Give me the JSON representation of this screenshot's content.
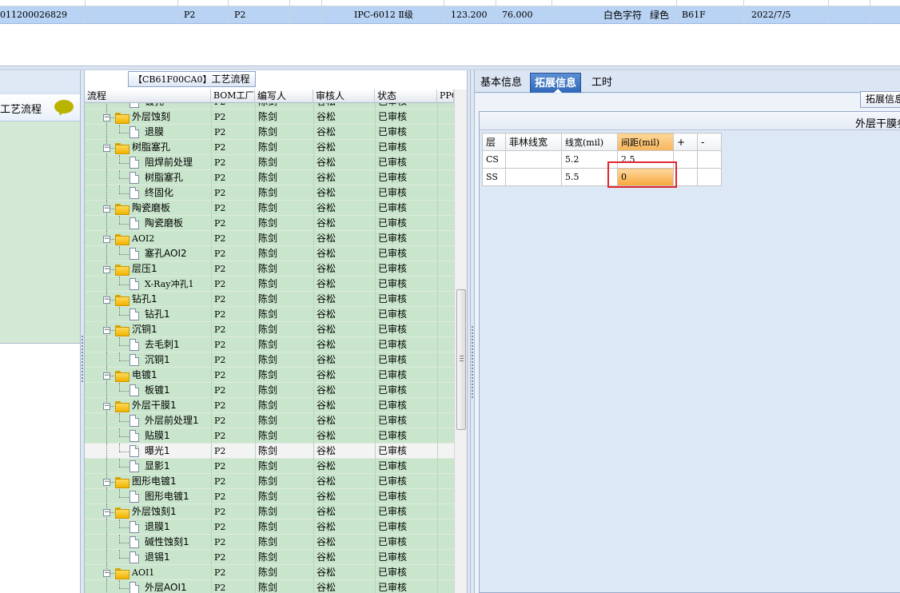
{
  "top_grid": {
    "selected_row": {
      "id": "011200026829",
      "factory1": "P2",
      "factory2": "P2",
      "material": "IPC-6012 Ⅱ级",
      "value1": "123.200",
      "value2": "76.000",
      "char_color": "白色字符",
      "mask_color": "绿色",
      "code": "B61F",
      "date": "2022/7/5"
    },
    "row_color": "#b9d3f4"
  },
  "left_panel": {
    "item_label": "工艺流程",
    "item_icon": "speech-bubble-icon"
  },
  "process_grid": {
    "caption_code": "【CB61F00CA0】",
    "caption_text": "工艺流程",
    "columns": [
      "流程",
      "BOM工厂",
      "编写人",
      "审核人",
      "状态",
      "PPC"
    ],
    "rows": [
      {
        "name": "镀孔",
        "type": "doc",
        "factory": "P2",
        "author": "陈剑",
        "reviewer": "谷松",
        "status": "已审核"
      },
      {
        "name": "外层蚀刻",
        "type": "folder",
        "factory": "P2",
        "author": "陈剑",
        "reviewer": "谷松",
        "status": "已审核"
      },
      {
        "name": "退膜",
        "type": "doc",
        "factory": "P2",
        "author": "陈剑",
        "reviewer": "谷松",
        "status": "已审核"
      },
      {
        "name": "树脂塞孔",
        "type": "folder",
        "factory": "P2",
        "author": "陈剑",
        "reviewer": "谷松",
        "status": "已审核"
      },
      {
        "name": "阻焊前处理",
        "type": "doc",
        "factory": "P2",
        "author": "陈剑",
        "reviewer": "谷松",
        "status": "已审核"
      },
      {
        "name": "树脂塞孔",
        "type": "doc",
        "factory": "P2",
        "author": "陈剑",
        "reviewer": "谷松",
        "status": "已审核"
      },
      {
        "name": "终固化",
        "type": "doc",
        "factory": "P2",
        "author": "陈剑",
        "reviewer": "谷松",
        "status": "已审核"
      },
      {
        "name": "陶瓷磨板",
        "type": "folder",
        "factory": "P2",
        "author": "陈剑",
        "reviewer": "谷松",
        "status": "已审核"
      },
      {
        "name": "陶瓷磨板",
        "type": "doc",
        "factory": "P2",
        "author": "陈剑",
        "reviewer": "谷松",
        "status": "已审核"
      },
      {
        "name": "AOI2",
        "type": "folder",
        "factory": "P2",
        "author": "陈剑",
        "reviewer": "谷松",
        "status": "已审核"
      },
      {
        "name": "塞孔AOI2",
        "type": "doc",
        "factory": "P2",
        "author": "陈剑",
        "reviewer": "谷松",
        "status": "已审核"
      },
      {
        "name": "层压1",
        "type": "folder",
        "factory": "P2",
        "author": "陈剑",
        "reviewer": "谷松",
        "status": "已审核"
      },
      {
        "name": "X-Ray冲孔1",
        "type": "doc",
        "factory": "P2",
        "author": "陈剑",
        "reviewer": "谷松",
        "status": "已审核"
      },
      {
        "name": "钻孔1",
        "type": "folder",
        "factory": "P2",
        "author": "陈剑",
        "reviewer": "谷松",
        "status": "已审核"
      },
      {
        "name": "钻孔1",
        "type": "doc",
        "factory": "P2",
        "author": "陈剑",
        "reviewer": "谷松",
        "status": "已审核"
      },
      {
        "name": "沉铜1",
        "type": "folder",
        "factory": "P2",
        "author": "陈剑",
        "reviewer": "谷松",
        "status": "已审核"
      },
      {
        "name": "去毛刺1",
        "type": "doc",
        "factory": "P2",
        "author": "陈剑",
        "reviewer": "谷松",
        "status": "已审核"
      },
      {
        "name": "沉铜1",
        "type": "doc",
        "factory": "P2",
        "author": "陈剑",
        "reviewer": "谷松",
        "status": "已审核"
      },
      {
        "name": "电镀1",
        "type": "folder",
        "factory": "P2",
        "author": "陈剑",
        "reviewer": "谷松",
        "status": "已审核"
      },
      {
        "name": "板镀1",
        "type": "doc",
        "factory": "P2",
        "author": "陈剑",
        "reviewer": "谷松",
        "status": "已审核"
      },
      {
        "name": "外层干膜1",
        "type": "folder",
        "factory": "P2",
        "author": "陈剑",
        "reviewer": "谷松",
        "status": "已审核"
      },
      {
        "name": "外层前处理1",
        "type": "doc",
        "factory": "P2",
        "author": "陈剑",
        "reviewer": "谷松",
        "status": "已审核"
      },
      {
        "name": "贴膜1",
        "type": "doc",
        "factory": "P2",
        "author": "陈剑",
        "reviewer": "谷松",
        "status": "已审核"
      },
      {
        "name": "曝光1",
        "type": "doc",
        "factory": "P2",
        "author": "陈剑",
        "reviewer": "谷松",
        "status": "已审核",
        "selected": true
      },
      {
        "name": "显影1",
        "type": "doc",
        "factory": "P2",
        "author": "陈剑",
        "reviewer": "谷松",
        "status": "已审核"
      },
      {
        "name": "图形电镀1",
        "type": "folder",
        "factory": "P2",
        "author": "陈剑",
        "reviewer": "谷松",
        "status": "已审核"
      },
      {
        "name": "图形电镀1",
        "type": "doc",
        "factory": "P2",
        "author": "陈剑",
        "reviewer": "谷松",
        "status": "已审核"
      },
      {
        "name": "外层蚀刻1",
        "type": "folder",
        "factory": "P2",
        "author": "陈剑",
        "reviewer": "谷松",
        "status": "已审核"
      },
      {
        "name": "退膜1",
        "type": "doc",
        "factory": "P2",
        "author": "陈剑",
        "reviewer": "谷松",
        "status": "已审核"
      },
      {
        "name": "碱性蚀刻1",
        "type": "doc",
        "factory": "P2",
        "author": "陈剑",
        "reviewer": "谷松",
        "status": "已审核"
      },
      {
        "name": "退锡1",
        "type": "doc",
        "factory": "P2",
        "author": "陈剑",
        "reviewer": "谷松",
        "status": "已审核"
      },
      {
        "name": "AOI1",
        "type": "folder",
        "factory": "P2",
        "author": "陈剑",
        "reviewer": "谷松",
        "status": "已审核"
      },
      {
        "name": "外层AOI1",
        "type": "doc",
        "factory": "P2",
        "author": "陈剑",
        "reviewer": "谷松",
        "status": "已审核"
      }
    ],
    "row_color": "#c9e6cc"
  },
  "right_panel": {
    "tabs": [
      {
        "label": "基本信息",
        "active": false
      },
      {
        "label": "拓展信息",
        "active": true
      },
      {
        "label": "工时",
        "active": false
      }
    ],
    "ext_button_label": "拓展信息",
    "inner_title": "外层干膜参",
    "table": {
      "headers": [
        "层",
        "菲林线宽",
        "线宽(mil)",
        "间距(mil)",
        "+",
        "-"
      ],
      "rows": [
        {
          "layer": "CS",
          "film_width": "",
          "line_width": "5.2",
          "spacing": "2.5"
        },
        {
          "layer": "SS",
          "film_width": "",
          "line_width": "5.5",
          "spacing": "0"
        }
      ]
    },
    "highlight_color": "#e0262f"
  }
}
